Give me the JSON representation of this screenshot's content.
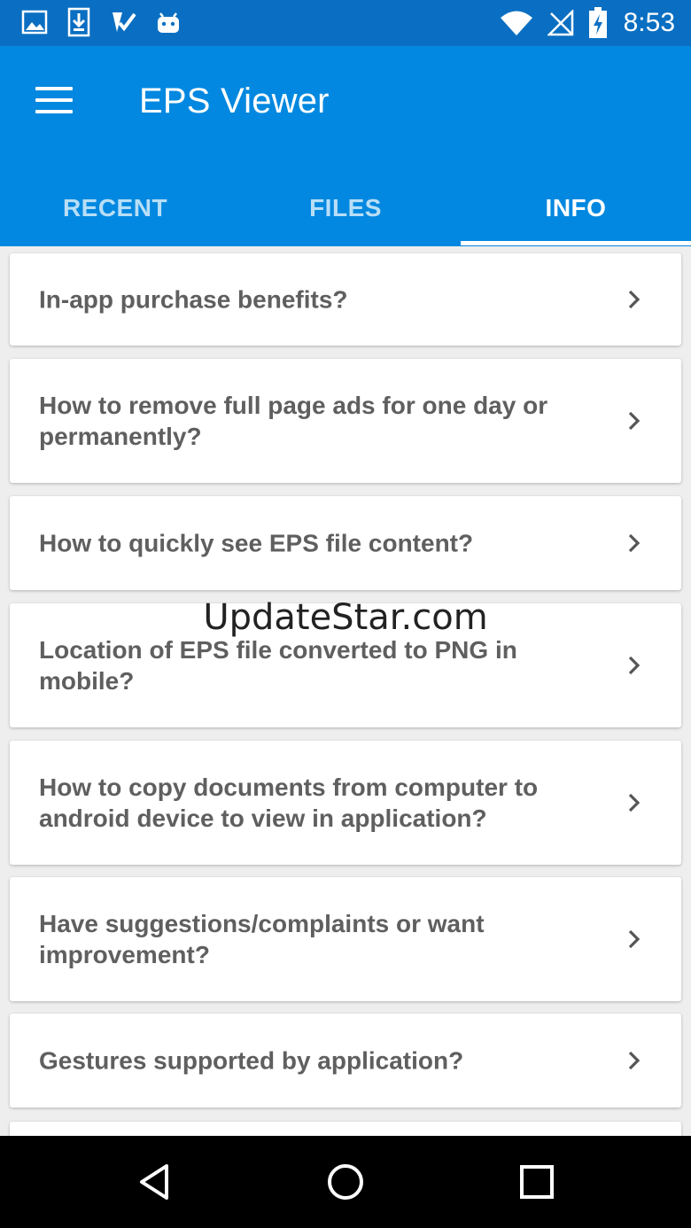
{
  "status_bar": {
    "icons_left": [
      "image-icon",
      "download-icon",
      "check-task-icon",
      "android-icon"
    ],
    "icons_right": [
      "wifi-icon",
      "no-signal-icon",
      "battery-charging-icon"
    ],
    "time": "8:53"
  },
  "app_bar": {
    "title": "EPS Viewer",
    "menu_icon": "hamburger-menu-icon",
    "color": "#0288e0"
  },
  "tabs": [
    {
      "label": "RECENT",
      "active": false
    },
    {
      "label": "FILES",
      "active": false
    },
    {
      "label": "INFO",
      "active": true
    }
  ],
  "info_items": [
    {
      "question": "In-app purchase benefits?"
    },
    {
      "question": "How to remove full page ads for one day or permanently?"
    },
    {
      "question": "How to quickly see EPS file content?"
    },
    {
      "question": "Location of EPS file converted to PNG in mobile?"
    },
    {
      "question": "How to copy documents from computer to android device to view in application?"
    },
    {
      "question": "Have suggestions/complaints or want improvement?"
    },
    {
      "question": "Gestures supported by application?"
    }
  ],
  "watermark": "UpdateStar.com",
  "nav_bar": {
    "buttons": [
      "back-icon",
      "home-icon",
      "recents-icon"
    ]
  }
}
